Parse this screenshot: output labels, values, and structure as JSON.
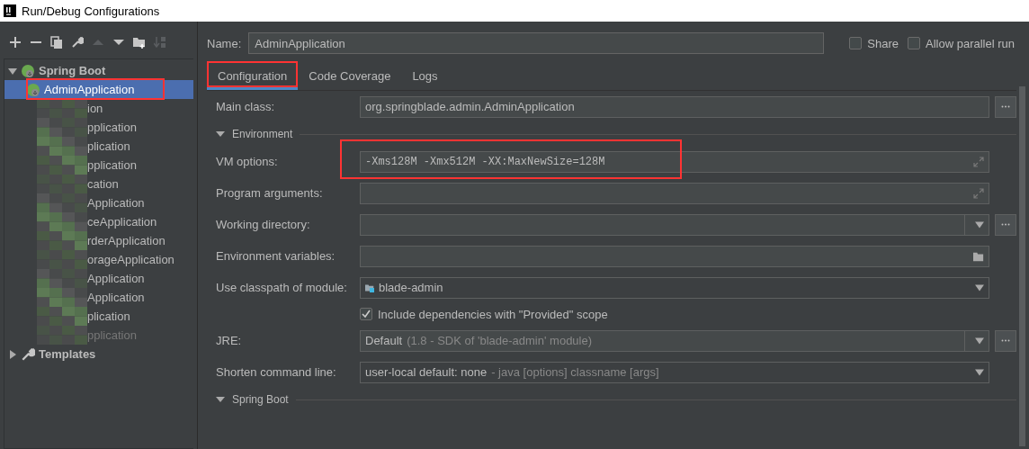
{
  "window": {
    "title": "Run/Debug Configurations"
  },
  "toolbar": {
    "buttons": [
      {
        "kind": "plus",
        "disabled": false
      },
      {
        "kind": "minus",
        "disabled": false
      },
      {
        "kind": "copy",
        "disabled": false
      },
      {
        "kind": "wrench",
        "disabled": false
      },
      {
        "kind": "up",
        "disabled": true
      },
      {
        "kind": "down",
        "disabled": false
      },
      {
        "kind": "folder",
        "disabled": false
      },
      {
        "kind": "sort",
        "disabled": true
      }
    ]
  },
  "tree": [
    {
      "label": "Spring Boot",
      "kind": "spring",
      "expanded": true,
      "children": [
        {
          "label": "AdminApplication",
          "selected": true,
          "highlighted": true,
          "disabled": false
        },
        {
          "label": "ion",
          "selected": false,
          "highlighted": false,
          "disabled": false
        },
        {
          "label": "pplication",
          "selected": false,
          "highlighted": false,
          "disabled": false
        },
        {
          "label": "plication",
          "selected": false,
          "highlighted": false,
          "disabled": false
        },
        {
          "label": "pplication",
          "selected": false,
          "highlighted": false,
          "disabled": false
        },
        {
          "label": "cation",
          "selected": false,
          "highlighted": false,
          "disabled": false
        },
        {
          "label": "Application",
          "selected": false,
          "highlighted": false,
          "disabled": false
        },
        {
          "label": "ceApplication",
          "selected": false,
          "highlighted": false,
          "disabled": false
        },
        {
          "label": "rderApplication",
          "selected": false,
          "highlighted": false,
          "disabled": false
        },
        {
          "label": "orageApplication",
          "selected": false,
          "highlighted": false,
          "disabled": false
        },
        {
          "label": "Application",
          "selected": false,
          "highlighted": false,
          "disabled": false
        },
        {
          "label": "Application",
          "selected": false,
          "highlighted": false,
          "disabled": false
        },
        {
          "label": "plication",
          "selected": false,
          "highlighted": false,
          "disabled": false
        },
        {
          "label": "pplication",
          "selected": false,
          "highlighted": false,
          "disabled": true
        }
      ]
    },
    {
      "label": "Templates",
      "kind": "wrench",
      "expanded": false
    }
  ],
  "name": {
    "label": "Name:",
    "value": "AdminApplication"
  },
  "options": [
    {
      "label": "Share",
      "checked": false
    },
    {
      "label": "Allow parallel run",
      "checked": false
    }
  ],
  "tabs": [
    {
      "label": "Configuration",
      "selected": true,
      "highlighted": true
    },
    {
      "label": "Code Coverage",
      "selected": false,
      "highlighted": false
    },
    {
      "label": "Logs",
      "selected": false,
      "highlighted": false
    }
  ],
  "form": [
    {
      "kind": "field",
      "label": "Main class:",
      "value": "org.springblade.admin.AdminApplication",
      "browse": true
    },
    {
      "kind": "section",
      "label": "Environment",
      "expanded": true
    },
    {
      "kind": "expand",
      "label": "VM options:",
      "value": "-Xms128M -Xmx512M -XX:MaxNewSize=128M",
      "highlighted": true
    },
    {
      "kind": "expand",
      "label": "Program arguments:",
      "highlighted": false
    },
    {
      "kind": "combo",
      "label": "Working directory:",
      "browse": true
    },
    {
      "kind": "folder",
      "label": "Environment variables:"
    },
    {
      "kind": "module",
      "label": "Use classpath of module:",
      "value": "blade-admin"
    },
    {
      "kind": "check",
      "label": "Include dependencies with \"Provided\" scope",
      "checked": true
    },
    {
      "kind": "combo",
      "label": "JRE:",
      "value": "Default",
      "detail": "(1.8 - SDK of 'blade-admin' module)",
      "browse": true
    },
    {
      "kind": "dropdown",
      "label": "Shorten command line:",
      "value": "user-local default: none",
      "detail": "- java [options] classname [args]"
    },
    {
      "kind": "section",
      "label": "Spring Boot",
      "expanded": true
    }
  ]
}
